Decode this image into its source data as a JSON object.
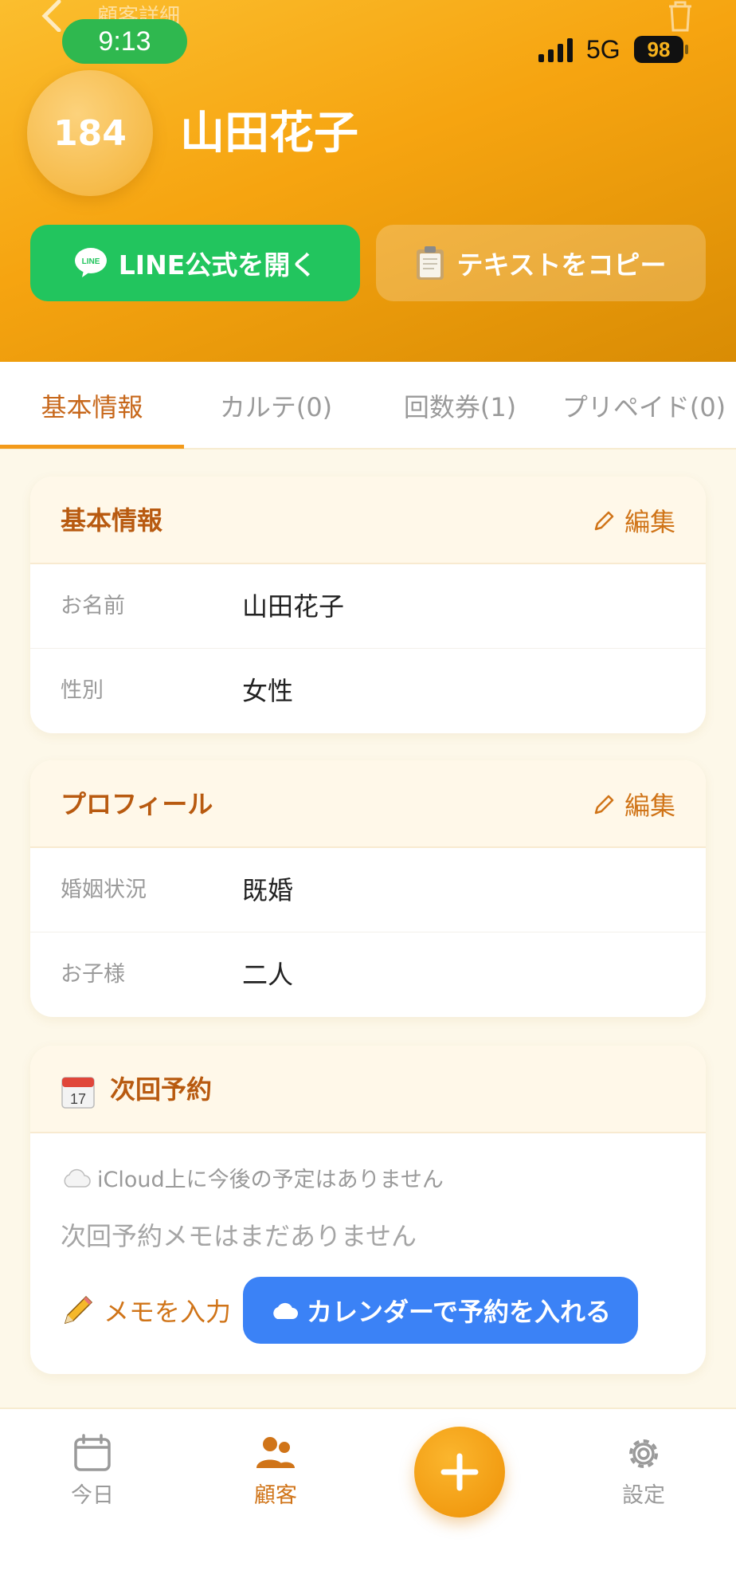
{
  "status_bar": {
    "time": "9:13",
    "network": "5G",
    "battery": "98",
    "nav_title": "顧客詳細"
  },
  "customer": {
    "number": "184",
    "name": "山田花子"
  },
  "actions": {
    "line_label": "LINE公式を開く",
    "copy_label": "テキストをコピー"
  },
  "tabs": [
    {
      "label": "基本情報",
      "active": true
    },
    {
      "label": "カルテ(0)",
      "active": false
    },
    {
      "label": "回数券(1)",
      "active": false
    },
    {
      "label": "プリペイド(0)",
      "active": false
    }
  ],
  "basic_info": {
    "title": "基本情報",
    "edit_label": "編集",
    "rows": [
      {
        "label": "お名前",
        "value": "山田花子"
      },
      {
        "label": "性別",
        "value": "女性"
      }
    ]
  },
  "profile": {
    "title": "プロフィール",
    "edit_label": "編集",
    "rows": [
      {
        "label": "婚姻状況",
        "value": "既婚"
      },
      {
        "label": "お子様",
        "value": "二人"
      }
    ]
  },
  "next_reservation": {
    "title": "次回予約",
    "icloud_note": "iCloud上に今後の予定はありません",
    "memo_empty": "次回予約メモはまだありません",
    "memo_button": "メモを入力",
    "calendar_button": "カレンダーで予約を入れる"
  },
  "bottom_nav": {
    "today": "今日",
    "customers": "顧客",
    "settings": "設定"
  },
  "colors": {
    "accent": "#f39a1a",
    "line_green": "#22c55e",
    "calendar_blue": "#3b82f6",
    "title_brown": "#b85a10"
  }
}
